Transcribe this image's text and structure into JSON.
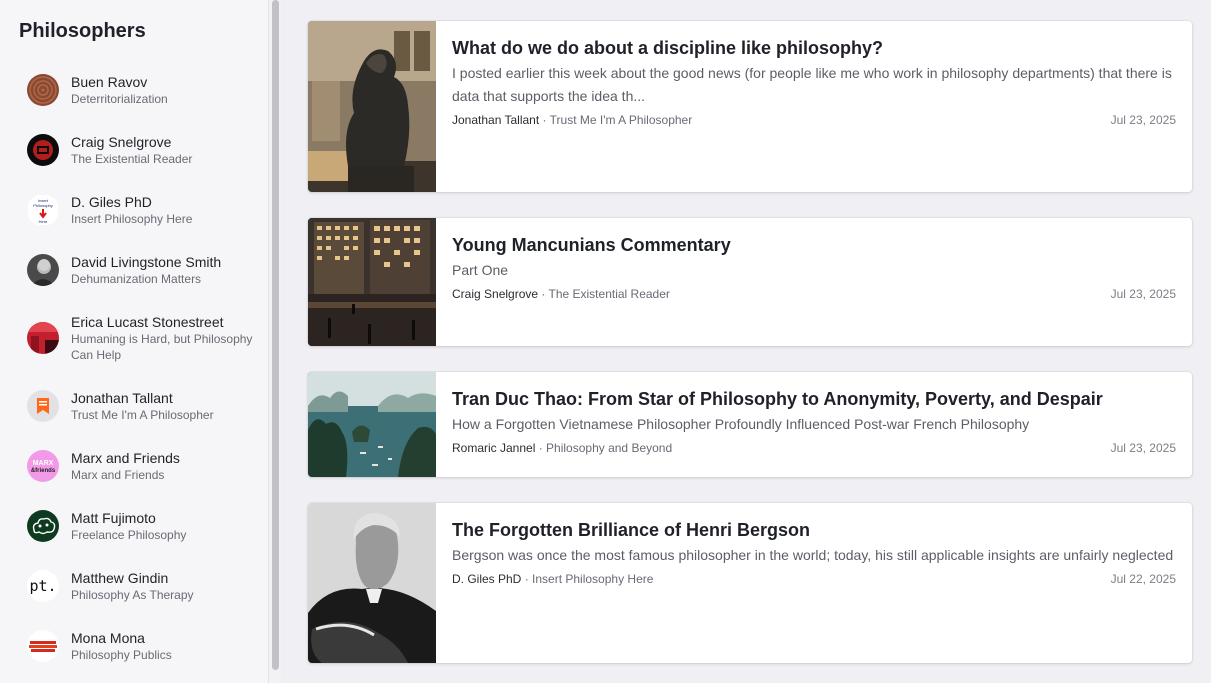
{
  "sidebar": {
    "title": "Philosophers",
    "items": [
      {
        "name": "Buen Ravov",
        "publication": "Deterritorialization",
        "icon": "wood-rings-avatar"
      },
      {
        "name": "Craig Snelgrove",
        "publication": "The Existential Reader",
        "icon": "red-emblem-avatar"
      },
      {
        "name": "D. Giles PhD",
        "publication": "Insert Philosophy Here",
        "icon": "insert-philosophy-logo",
        "logo_lines": [
          "Insert",
          "Philosophy",
          "Here"
        ]
      },
      {
        "name": "David Livingstone Smith",
        "publication": "Dehumanization Matters",
        "icon": "portrait-avatar"
      },
      {
        "name": "Erica Lucast Stonestreet",
        "publication": "Humaning is Hard, but Philosophy Can Help",
        "icon": "red-building-avatar"
      },
      {
        "name": "Jonathan Tallant",
        "publication": "Trust Me I'm A Philosopher",
        "icon": "bookmark-icon"
      },
      {
        "name": "Marx and Friends",
        "publication": "Marx and Friends",
        "icon": "marx-friends-logo",
        "logo_lines": [
          "MARX",
          "&friends"
        ]
      },
      {
        "name": "Matt Fujimoto",
        "publication": "Freelance Philosophy",
        "icon": "cloud-logo"
      },
      {
        "name": "Matthew Gindin",
        "publication": "Philosophy As Therapy",
        "icon": "pt-logo",
        "logo_text": "pt."
      },
      {
        "name": "Mona Mona",
        "publication": "Philosophy Publics",
        "icon": "red-text-logo"
      }
    ]
  },
  "posts": [
    {
      "title": "What do we do about a discipline like philosophy?",
      "subtitle": "I posted earlier this week about the good news (for people like me who work in philosophy departments) that there is data that supports the idea th...",
      "author": "Jonathan Tallant",
      "publication": "Trust Me I'm A Philosopher",
      "separator": " · ",
      "date": "Jul 23, 2025",
      "thumb": "thinker-statue-image"
    },
    {
      "title": "Young Mancunians Commentary",
      "subtitle": "Part One",
      "author": "Craig Snelgrove",
      "publication": "The Existential Reader",
      "separator": " · ",
      "date": "Jul 23, 2025",
      "thumb": "city-night-image"
    },
    {
      "title": "Tran Duc Thao: From Star of Philosophy to Anonymity, Poverty, and Despair",
      "subtitle": "How a Forgotten Vietnamese Philosopher Profoundly Influenced Post-war French Philosophy",
      "author": "Romaric Jannel",
      "publication": "Philosophy and Beyond",
      "separator": " · ",
      "date": "Jul 23, 2025",
      "thumb": "bay-islands-image"
    },
    {
      "title": "The Forgotten Brilliance of Henri Bergson",
      "subtitle": "Bergson was once the most famous philosopher in the world; today, his still applicable insights are unfairly neglected",
      "author": "D. Giles PhD",
      "publication": "Insert Philosophy Here",
      "separator": " · ",
      "date": "Jul 22, 2025",
      "thumb": "bergson-portrait-image"
    }
  ]
}
